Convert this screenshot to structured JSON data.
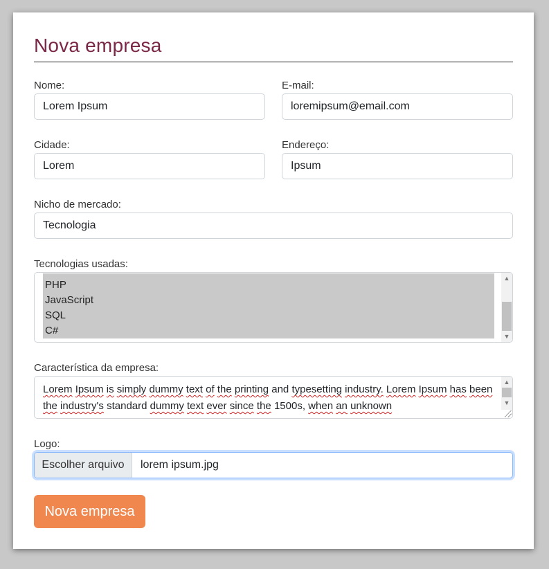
{
  "form": {
    "title": "Nova empresa",
    "fields": {
      "nome": {
        "label": "Nome:",
        "value": "Lorem Ipsum"
      },
      "email": {
        "label": "E-mail:",
        "value": "loremipsum@email.com"
      },
      "cidade": {
        "label": "Cidade:",
        "value": "Lorem"
      },
      "endereco": {
        "label": "Endereço:",
        "value": "Ipsum"
      },
      "nicho": {
        "label": "Nicho de mercado:",
        "value": "Tecnologia"
      },
      "tecnologias": {
        "label": "Tecnologias usadas:",
        "options": [
          "PHP",
          "JavaScript",
          "SQL",
          "C#"
        ]
      },
      "caracteristica": {
        "label": "Característica da empresa:",
        "value": "Lorem Ipsum is simply dummy text of the printing and typesetting industry. Lorem Ipsum has been the industry's standard dummy text ever since the 1500s, when an unknown"
      },
      "logo": {
        "label": "Logo:",
        "button_label": "Escolher arquivo",
        "file_name": "lorem ipsum.jpg"
      }
    },
    "submit_label": "Nova empresa"
  },
  "colors": {
    "title": "#7b2846",
    "submit": "#f0874f",
    "selected_options": "#c9c9c9",
    "focus_border": "#86b7fe"
  }
}
